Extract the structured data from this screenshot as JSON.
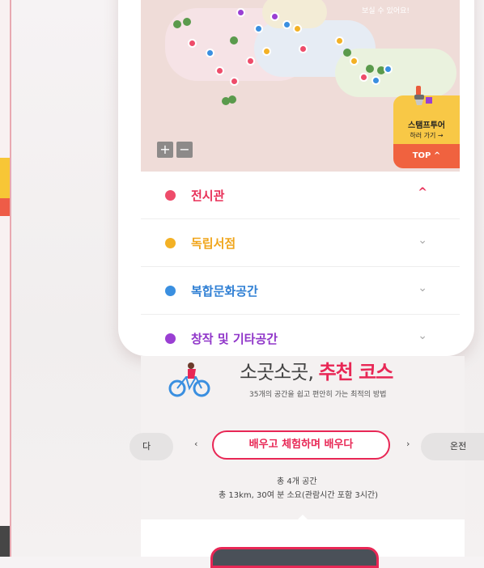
{
  "map": {
    "note": "보실 수 있어요!",
    "zoom_in": "+",
    "zoom_out": "−",
    "stamp_tour": {
      "title": "스탬프투어",
      "sub": "하러 가기 →"
    },
    "top_button": "TOP ^"
  },
  "categories": [
    {
      "label": "전시관",
      "color": "#ee4c6a",
      "chevron": "^",
      "expanded": true
    },
    {
      "label": "독립서점",
      "color": "#f3b125",
      "chevron": "⌄",
      "expanded": false
    },
    {
      "label": "복합문화공간",
      "color": "#3a8fe0",
      "chevron": "⌄",
      "expanded": false
    },
    {
      "label": "창작 및 기타공간",
      "color": "#9a3fd3",
      "chevron": "⌄",
      "expanded": false
    }
  ],
  "course": {
    "title_plain": "소곳소곳,",
    "title_accent": "추천 코스",
    "description": "35개의 공간을 쉽고 편안히 가는 최적의 방법",
    "prev_pill": "다",
    "current_pill": "배우고 체험하며 배우다",
    "next_pill": "온전",
    "prev_arrow": "‹",
    "next_arrow": "›",
    "stat_count": "총 4개 공간",
    "stat_detail": "총 13km, 30여 분 소요(관람시간 포함 3시간)"
  },
  "colors": {
    "accent": "#e82755",
    "top_button": "#f0623f",
    "stamp": "#f8c846"
  }
}
